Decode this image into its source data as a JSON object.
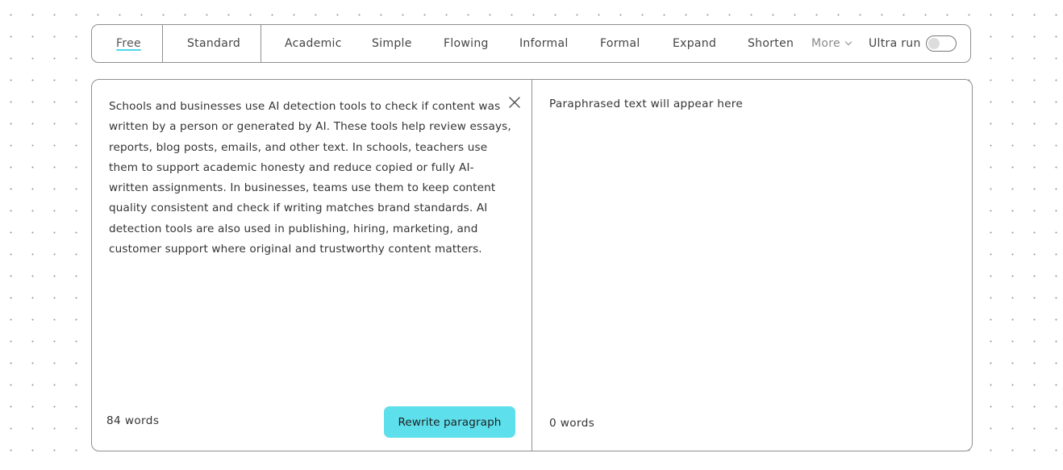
{
  "modes": {
    "free": "Free",
    "standard": "Standard",
    "academic": "Academic",
    "simple": "Simple",
    "flowing": "Flowing",
    "informal": "Informal",
    "formal": "Formal",
    "expand": "Expand",
    "shorten": "Shorten",
    "more": "More",
    "selected": "Free"
  },
  "ultra": {
    "label": "Ultra run",
    "enabled": false
  },
  "input": {
    "text": "Schools and businesses use AI detection tools to check if content was written by a person or generated by AI. These tools help review essays, reports, blog posts, emails, and other text. In schools, teachers use them to support academic honesty and reduce copied or fully AI-written assignments. In businesses, teams use them to keep content quality consistent and check if writing matches brand standards. AI detection tools are also used in publishing, hiring, marketing, and customer support where original and trustworthy content matters.",
    "word_count": "84 words",
    "close_icon": "close-icon"
  },
  "actions": {
    "rewrite_label": "Rewrite paragraph"
  },
  "output": {
    "placeholder": "Paraphrased text will appear here",
    "word_count": "0 words"
  },
  "colors": {
    "accent": "#5ddfec",
    "underline": "#4fd7e8",
    "border": "#8f8f8f",
    "text": "#333333"
  }
}
